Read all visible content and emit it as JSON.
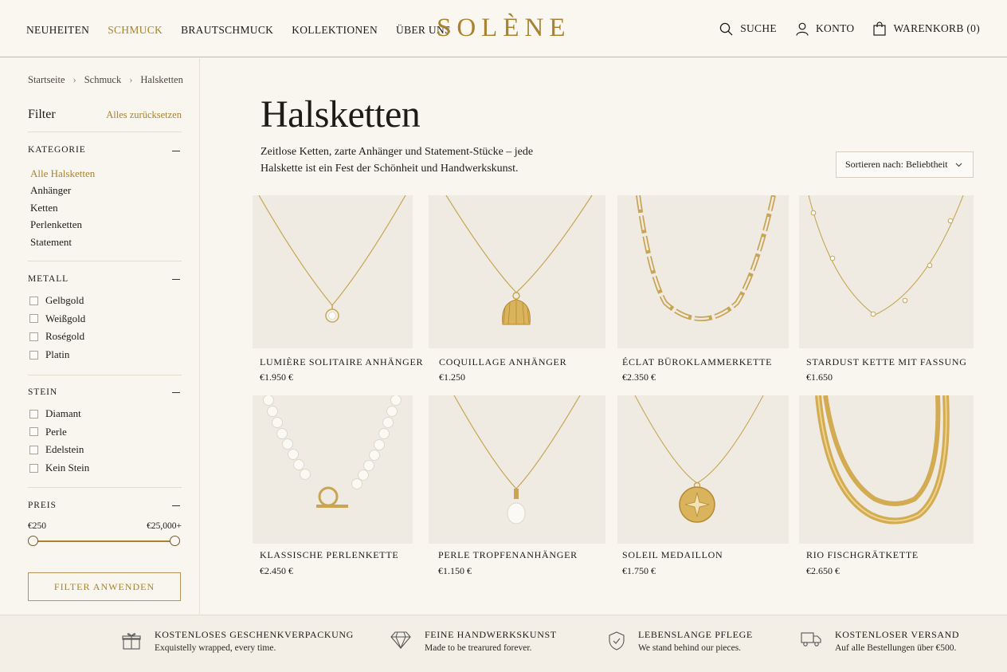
{
  "brand": {
    "logo": "SOLÈNE",
    "accent": "#a8832f"
  },
  "nav": {
    "items": [
      "NEUHEITEN",
      "SCHMUCK",
      "BRAUTSCHMUCK",
      "KOLLEKTIONEN",
      "ÜBER UNS"
    ],
    "active": "SCHMUCK"
  },
  "utils": {
    "search": "SUCHE",
    "account": "KONTO",
    "cart": "WARENKORB (0)"
  },
  "breadcrumb": [
    "Startseite",
    "Schmuck",
    "Halsketten"
  ],
  "filter": {
    "title": "Filter",
    "reset": "Alles zurücksetzen",
    "category": {
      "title": "KATEGORIE",
      "items": [
        "Alle Halsketten",
        "Anhänger",
        "Ketten",
        "Perlenketten",
        "Statement"
      ],
      "active": "Alle Halsketten"
    },
    "metal": {
      "title": "METALL",
      "items": [
        "Gelbgold",
        "Weißgold",
        "Roségold",
        "Platin"
      ]
    },
    "stone": {
      "title": "STEIN",
      "items": [
        "Diamant",
        "Perle",
        "Edelstein",
        "Kein Stein"
      ]
    },
    "price": {
      "title": "PREIS",
      "min": "€250",
      "max": "€25,000+"
    },
    "apply": "FILTER ANWENDEN"
  },
  "main": {
    "title": "Halsketten",
    "description": "Zeitlose Ketten, zarte Anhänger und Statement-Stücke – jede Halskette ist ein Fest der Schönheit und Handwerkskunst.",
    "sort": "Sortieren nach: Beliebtheit"
  },
  "products": [
    {
      "name": "LUMIÈRE SOLITAIRE ANHÄNGER",
      "price": "€1.950 €",
      "image": "solitaire-pendant"
    },
    {
      "name": "COQUILLAGE ANHÄNGER",
      "price": "€1.250",
      "image": "shell-pendant"
    },
    {
      "name": "ÉCLAT BÜROKLAMMERKETTE",
      "price": "€2.350 €",
      "image": "paperclip-chain"
    },
    {
      "name": "STARDUST KETTE MIT FASSUNG",
      "price": "€1.650",
      "image": "station-chain"
    },
    {
      "name": "KLASSISCHE PERLENKETTE",
      "price": "€2.450 €",
      "image": "pearl-necklace"
    },
    {
      "name": "PERLE TROPFENANHÄNGER",
      "price": "€1.150 €",
      "image": "pearl-drop"
    },
    {
      "name": "SOLEIL MEDAILLON",
      "price": "€1.750 €",
      "image": "medallion"
    },
    {
      "name": "RIO FISCHGRÄTKETTE",
      "price": "€2.650 €",
      "image": "herringbone-chain"
    }
  ],
  "features": [
    {
      "title": "KOSTENLOSES GESCHENKVERPACKUNG",
      "subtitle": "Exquistelly wrapped, every time.",
      "icon": "gift-icon"
    },
    {
      "title": "FEINE HANDWERKSKUNST",
      "subtitle": "Made to be trearured forever.",
      "icon": "diamond-icon"
    },
    {
      "title": "LEBENSLANGE PFLEGE",
      "subtitle": "We stand behind our pieces.",
      "icon": "shield-check-icon"
    },
    {
      "title": "KOSTENLOSER VERSAND",
      "subtitle": "Auf alle Bestellungen über €500.",
      "icon": "truck-icon"
    }
  ]
}
